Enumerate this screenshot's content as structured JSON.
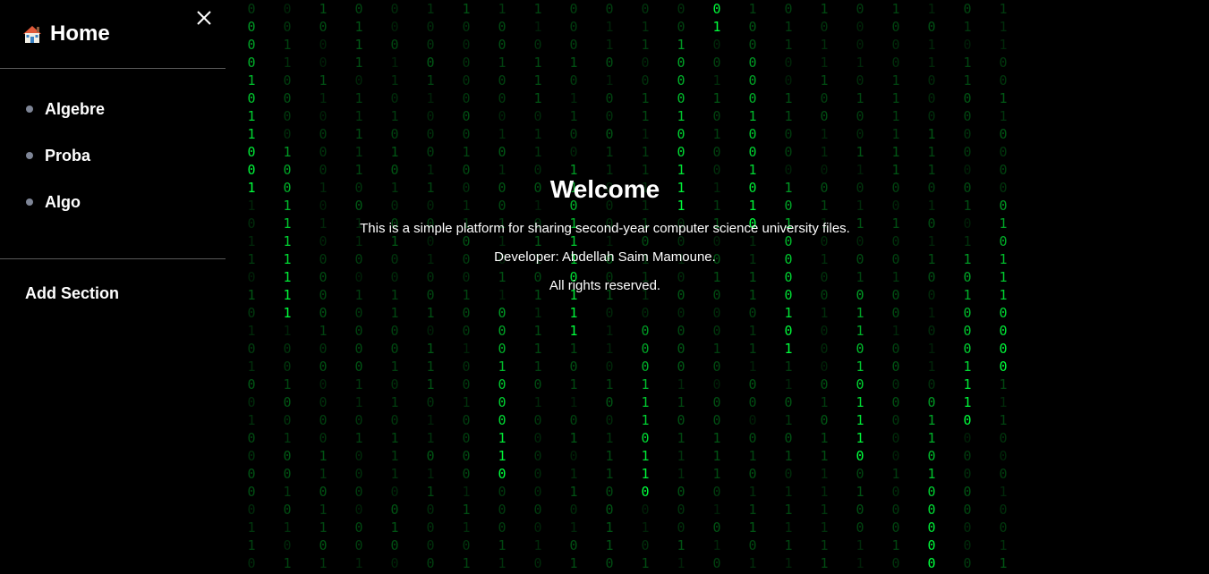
{
  "sidebar": {
    "home_label": "Home",
    "home_icon": "house-icon",
    "close_icon": "close-icon",
    "items": [
      {
        "label": "Algebre"
      },
      {
        "label": "Proba"
      },
      {
        "label": "Algo"
      }
    ],
    "add_section_label": "Add Section"
  },
  "main": {
    "title": "Welcome",
    "description": "This is a simple platform for sharing second-year computer science university files.",
    "developer": "Developer: Abdellah Saim Mamoune.",
    "rights": "All rights reserved."
  },
  "background": {
    "effect": "matrix-binary-rain",
    "glyphs": [
      "0",
      "1"
    ],
    "color_bright": "#00ff3c",
    "color_dim": "#0a3a10"
  },
  "colors": {
    "background": "#000000",
    "text": "#ffffff",
    "bullet": "#7e8596",
    "divider": "#5a5a5a"
  }
}
